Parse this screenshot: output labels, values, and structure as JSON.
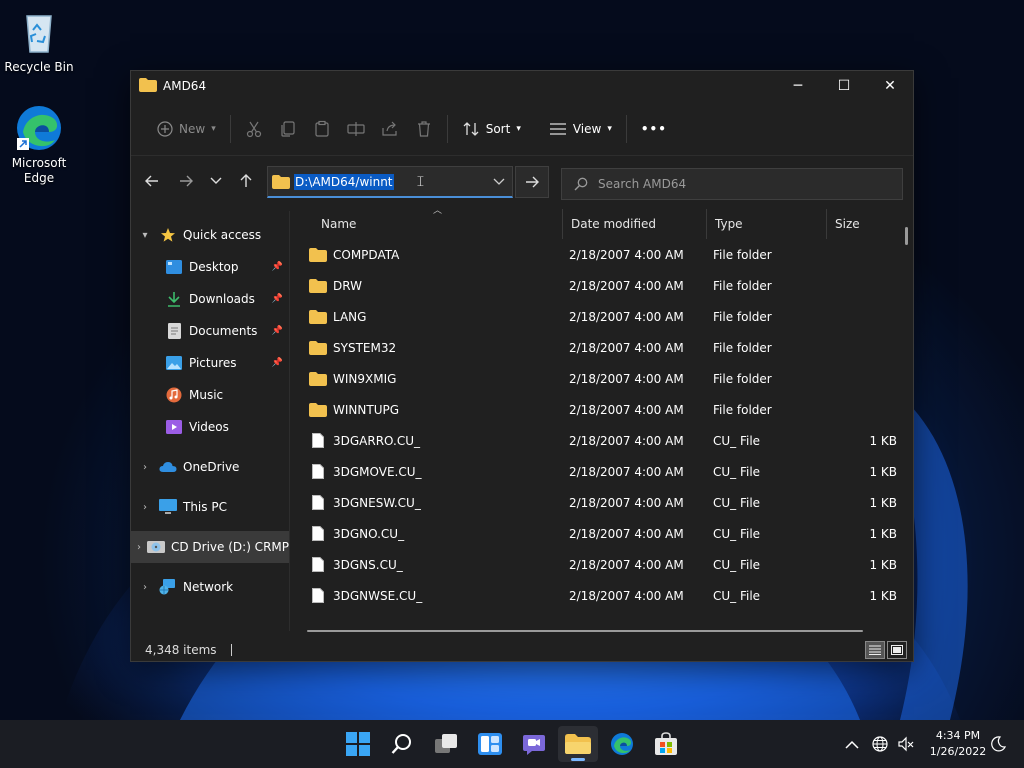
{
  "desktop": {
    "icons": [
      {
        "label": "Recycle Bin"
      },
      {
        "label": "Microsoft Edge"
      }
    ]
  },
  "window": {
    "title": "AMD64",
    "controls": {
      "minimize": "─",
      "maximize": "☐",
      "close": "✕"
    },
    "commands": {
      "new": "New",
      "sort": "Sort",
      "view": "View",
      "more": "•••"
    },
    "address": {
      "path": "D:\\AMD64/winnt"
    },
    "search": {
      "placeholder": "Search AMD64"
    },
    "sidebar": {
      "quick_access": "Quick access",
      "quick_items": [
        {
          "label": "Desktop"
        },
        {
          "label": "Downloads"
        },
        {
          "label": "Documents"
        },
        {
          "label": "Pictures"
        },
        {
          "label": "Music"
        },
        {
          "label": "Videos"
        }
      ],
      "onedrive": "OneDrive",
      "thispc": "This PC",
      "cddrive": "CD Drive (D:) CRMP",
      "network": "Network"
    },
    "columns": {
      "name": "Name",
      "date": "Date modified",
      "type": "Type",
      "size": "Size"
    },
    "files": [
      {
        "name": "COMPDATA",
        "date": "2/18/2007 4:00 AM",
        "type": "File folder",
        "size": "",
        "kind": "folder"
      },
      {
        "name": "DRW",
        "date": "2/18/2007 4:00 AM",
        "type": "File folder",
        "size": "",
        "kind": "folder"
      },
      {
        "name": "LANG",
        "date": "2/18/2007 4:00 AM",
        "type": "File folder",
        "size": "",
        "kind": "folder"
      },
      {
        "name": "SYSTEM32",
        "date": "2/18/2007 4:00 AM",
        "type": "File folder",
        "size": "",
        "kind": "folder"
      },
      {
        "name": "WIN9XMIG",
        "date": "2/18/2007 4:00 AM",
        "type": "File folder",
        "size": "",
        "kind": "folder"
      },
      {
        "name": "WINNTUPG",
        "date": "2/18/2007 4:00 AM",
        "type": "File folder",
        "size": "",
        "kind": "folder"
      },
      {
        "name": "3DGARRO.CU_",
        "date": "2/18/2007 4:00 AM",
        "type": "CU_ File",
        "size": "1 KB",
        "kind": "file"
      },
      {
        "name": "3DGMOVE.CU_",
        "date": "2/18/2007 4:00 AM",
        "type": "CU_ File",
        "size": "1 KB",
        "kind": "file"
      },
      {
        "name": "3DGNESW.CU_",
        "date": "2/18/2007 4:00 AM",
        "type": "CU_ File",
        "size": "1 KB",
        "kind": "file"
      },
      {
        "name": "3DGNO.CU_",
        "date": "2/18/2007 4:00 AM",
        "type": "CU_ File",
        "size": "1 KB",
        "kind": "file"
      },
      {
        "name": "3DGNS.CU_",
        "date": "2/18/2007 4:00 AM",
        "type": "CU_ File",
        "size": "1 KB",
        "kind": "file"
      },
      {
        "name": "3DGNWSE.CU_",
        "date": "2/18/2007 4:00 AM",
        "type": "CU_ File",
        "size": "1 KB",
        "kind": "file"
      }
    ],
    "status": {
      "items": "4,348 items"
    }
  },
  "taskbar": {
    "clock_time": "4:34 PM",
    "clock_date": "1/26/2022"
  },
  "colors": {
    "accent": "#0a5bc4",
    "folder": "#f2c14e",
    "window_bg": "#202020"
  }
}
